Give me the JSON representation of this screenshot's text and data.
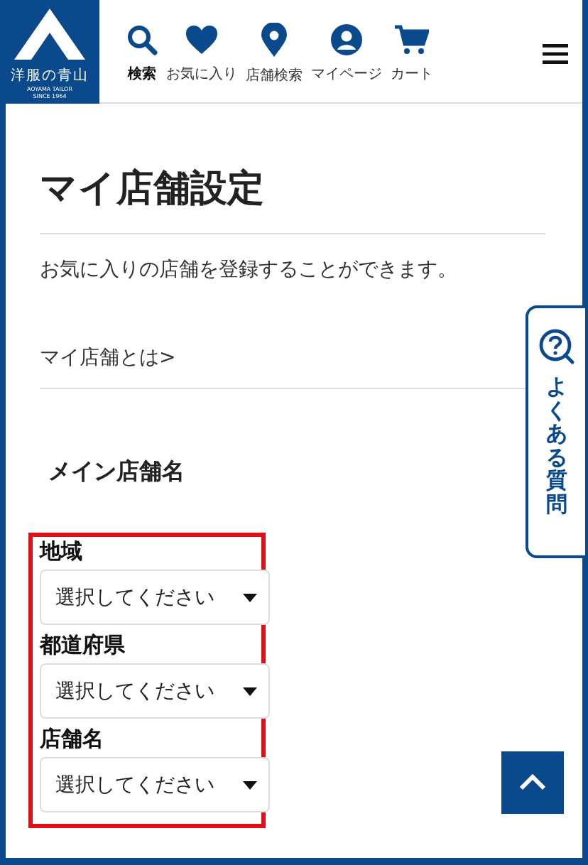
{
  "logo": {
    "name": "洋服の青山",
    "tagline": "AOYAMA TAILOR",
    "since": "SINCE 1964"
  },
  "nav": [
    {
      "kind": "search",
      "label": "検索",
      "selected": true
    },
    {
      "kind": "heart",
      "label": "お気に入り",
      "selected": false
    },
    {
      "kind": "pin",
      "label": "店舗検索",
      "selected": false
    },
    {
      "kind": "user",
      "label": "マイページ",
      "selected": false
    },
    {
      "kind": "cart",
      "label": "カート",
      "selected": false
    }
  ],
  "title": "マイ店舗設定",
  "description": "お気に入りの店舗を登録することができます。",
  "about_link": "マイ店舗とは>",
  "section_title": "メイン店舗名",
  "fields": [
    {
      "label": "地域",
      "value": "選択してください"
    },
    {
      "label": "都道府県",
      "value": "選択してください"
    },
    {
      "label": "店舗名",
      "value": "選択してください"
    }
  ],
  "faq_tab": "よくある質問"
}
